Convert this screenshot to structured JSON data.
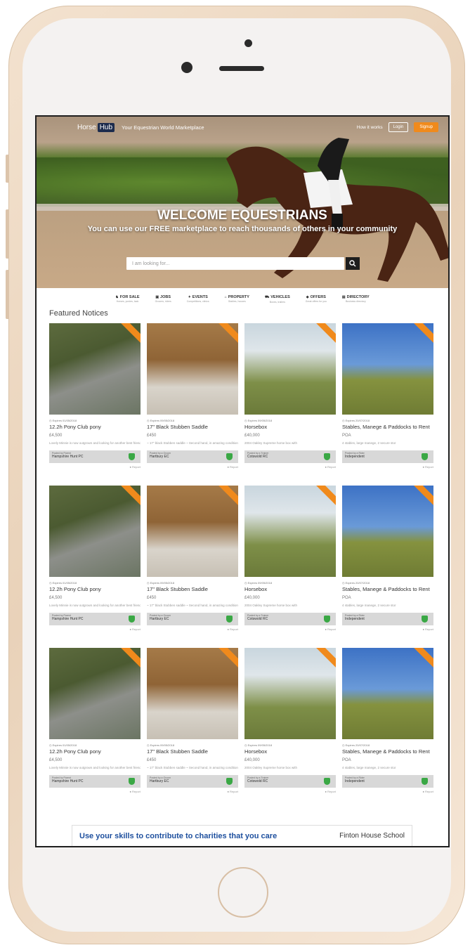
{
  "header": {
    "logo_text": "Horse",
    "logo_badge": "Hub",
    "tagline": "Your Equestrian World Marketplace",
    "how_it_works": "How it works",
    "login_label": "Login",
    "signup_label": "Signup"
  },
  "hero": {
    "title": "WELCOME EQUESTRIANS",
    "subtitle": "You can use our FREE marketplace to reach thousands of others in your community",
    "search_placeholder": "I am looking for..."
  },
  "categories": [
    {
      "label": "FOR SALE",
      "sub": "Horses, ponies, tack",
      "icon": "horse-icon",
      "glyph": "♞"
    },
    {
      "label": "JOBS",
      "sub": "Grooms, riders",
      "icon": "briefcase-icon",
      "glyph": "▣"
    },
    {
      "label": "EVENTS",
      "sub": "Competitions, clinics",
      "icon": "calendar-icon",
      "glyph": "✦"
    },
    {
      "label": "PROPERTY",
      "sub": "Stables, houses",
      "icon": "home-icon",
      "glyph": "⌂"
    },
    {
      "label": "VEHICLES",
      "sub": "Boxes, trailers",
      "icon": "truck-icon",
      "glyph": "⛟"
    },
    {
      "label": "OFFERS",
      "sub": "Great offers for you",
      "icon": "tag-icon",
      "glyph": "◆"
    },
    {
      "label": "DIRECTORY",
      "sub": "Business directory",
      "icon": "book-icon",
      "glyph": "▤"
    }
  ],
  "section": {
    "title": "Featured Notices"
  },
  "notices": [
    {
      "img": "pony",
      "expires": "Expires 01/05/2018",
      "title": "12.2h Pony Club pony",
      "price": "£4,500",
      "desc": "Lovely Minnie is now outgrown and looking for another best friend. She has been a",
      "posted_by": "Posted by Parent",
      "club": "Hampshire Hunt PC",
      "report": "Report"
    },
    {
      "img": "saddle",
      "expires": "Expires 09/05/2018",
      "title": "17\" Black Stubben Saddle",
      "price": "£450",
      "desc": "~ 17\" black Stubben saddle ~ Second hand, in amazing condition ~ Always been very",
      "posted_by": "Posted by a Groom",
      "club": "Hartbury EC",
      "report": "Report"
    },
    {
      "img": "box",
      "expires": "Expires 09/05/2018",
      "title": "Horsebox",
      "price": "£40,000",
      "desc": "2004 Oakley Supreme horse box with",
      "posted_by": "Posted by a Trainer",
      "club": "Cotswold RC",
      "report": "Report"
    },
    {
      "img": "stable",
      "expires": "Expires 20/07/2018",
      "title": "Stables, Manege & Paddocks to Rent",
      "price": "POA",
      "desc": "4 stables, large manege, 2 secure stor",
      "posted_by": "Posted by a Rider",
      "club": "Independent",
      "report": "Report"
    },
    {
      "img": "pony",
      "expires": "Expires 01/05/2018",
      "title": "12.2h Pony Club pony",
      "price": "£4,500",
      "desc": "Lovely Minnie is now outgrown and looking for another best friend. She has been a",
      "posted_by": "Posted by Parent",
      "club": "Hampshire Hunt PC",
      "report": "Report"
    },
    {
      "img": "saddle",
      "expires": "Expires 09/05/2018",
      "title": "17\" Black Stubben Saddle",
      "price": "£450",
      "desc": "~ 17\" black Stubben saddle ~ Second hand, in amazing condition ~ Always been very",
      "posted_by": "Posted by a Groom",
      "club": "Hartbury EC",
      "report": "Report"
    },
    {
      "img": "box",
      "expires": "Expires 09/05/2018",
      "title": "Horsebox",
      "price": "£40,000",
      "desc": "2004 Oakley Supreme horse box with",
      "posted_by": "Posted by a Trainer",
      "club": "Cotswold RC",
      "report": "Report"
    },
    {
      "img": "stable",
      "expires": "Expires 20/07/2018",
      "title": "Stables, Manege & Paddocks to Rent",
      "price": "POA",
      "desc": "4 stables, large manege, 2 secure stor",
      "posted_by": "Posted by a Rider",
      "club": "Independent",
      "report": "Report"
    },
    {
      "img": "pony",
      "expires": "Expires 01/05/2018",
      "title": "12.2h Pony Club pony",
      "price": "£4,500",
      "desc": "Lovely Minnie is now outgrown and looking for another best friend. She has been a",
      "posted_by": "Posted by Parent",
      "club": "Hampshire Hunt PC",
      "report": "Report"
    },
    {
      "img": "saddle",
      "expires": "Expires 09/05/2018",
      "title": "17\" Black Stubben Saddle",
      "price": "£450",
      "desc": "~ 17\" black Stubben saddle ~ Second hand, in amazing condition ~ Always been very",
      "posted_by": "Posted by a Groom",
      "club": "Hartbury EC",
      "report": "Report"
    },
    {
      "img": "box",
      "expires": "Expires 09/05/2018",
      "title": "Horsebox",
      "price": "£40,000",
      "desc": "2004 Oakley Supreme horse box with",
      "posted_by": "Posted by a Trainer",
      "club": "Cotswold RC",
      "report": "Report"
    },
    {
      "img": "stable",
      "expires": "Expires 20/07/2018",
      "title": "Stables, Manege & Paddocks to Rent",
      "price": "POA",
      "desc": "4 stables, large manege, 2 secure stor",
      "posted_by": "Posted by a Rider",
      "club": "Independent",
      "report": "Report"
    }
  ],
  "banner": {
    "left": "Use your skills to contribute to charities that you care",
    "right": "Finton House School"
  },
  "colors": {
    "accent": "#f08a1c",
    "verified": "#3aa845",
    "banner_text": "#1d4f9e"
  }
}
